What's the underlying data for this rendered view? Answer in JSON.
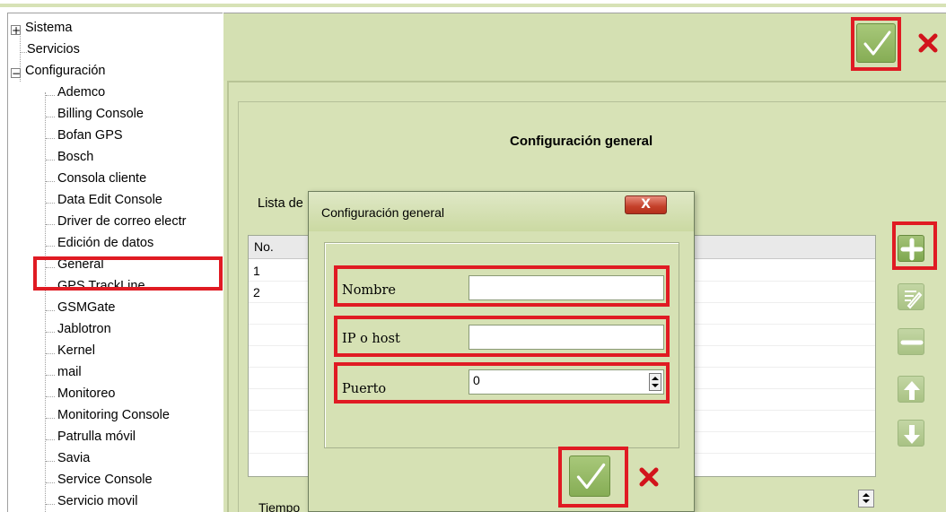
{
  "tree": {
    "items": [
      {
        "label": "Sistema",
        "expander": "+"
      },
      {
        "label": "Servicios"
      },
      {
        "label": "Configuración",
        "expander": "−"
      },
      {
        "label": "Ademco"
      },
      {
        "label": "Billing Console"
      },
      {
        "label": "Bofan GPS"
      },
      {
        "label": "Bosch"
      },
      {
        "label": "Consola cliente"
      },
      {
        "label": "Data Edit Console"
      },
      {
        "label": "Driver de correo electr"
      },
      {
        "label": "Edición de datos"
      },
      {
        "label": "General"
      },
      {
        "label": "GPS TrackLine"
      },
      {
        "label": "GSMGate"
      },
      {
        "label": "Jablotron"
      },
      {
        "label": "Kernel"
      },
      {
        "label": "mail"
      },
      {
        "label": "Monitoreo"
      },
      {
        "label": "Monitoring Console"
      },
      {
        "label": "Patrulla móvil"
      },
      {
        "label": "Savia"
      },
      {
        "label": "Service Console"
      },
      {
        "label": "Servicio movil"
      }
    ]
  },
  "main": {
    "section_title": "Configuración general",
    "list_label": "Lista de",
    "table": {
      "column_no": "No.",
      "rows": [
        "1",
        "2"
      ]
    },
    "tiempo_label": "Tiempo"
  },
  "dialog": {
    "title": "Configuración general",
    "close_label": "X",
    "fields": {
      "nombre_label": "Nombre",
      "nombre_value": "",
      "host_label": "IP o host",
      "host_value": "",
      "puerto_label": "Puerto",
      "puerto_value": "0"
    }
  },
  "icons": {
    "accept": "check-icon",
    "cancel": "close-icon",
    "add": "plus-icon",
    "edit": "edit-icon",
    "remove": "minus-icon",
    "up": "arrow-up-icon",
    "down": "arrow-down-icon"
  },
  "colors": {
    "highlight": "#e01b23",
    "panel": "#d7e2b6",
    "button": "#8db15e"
  }
}
